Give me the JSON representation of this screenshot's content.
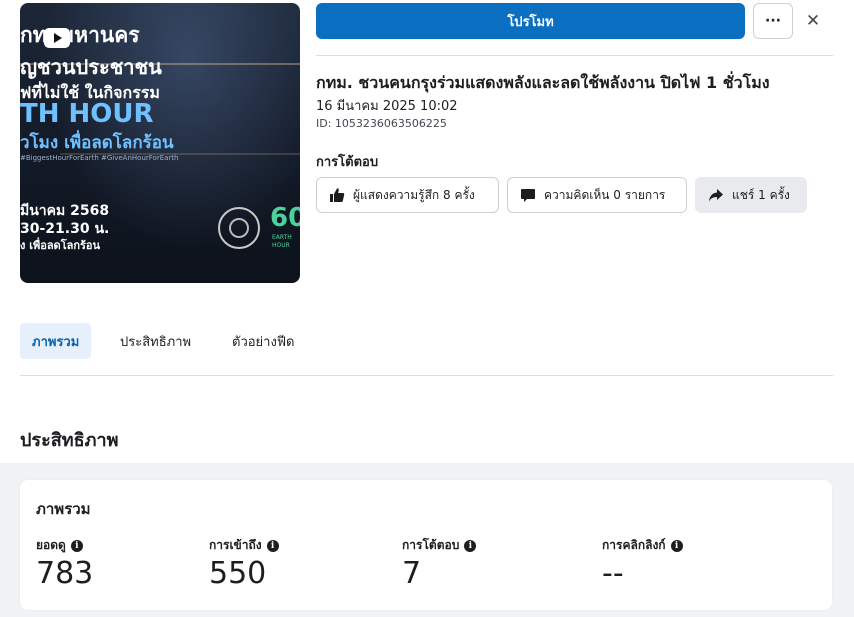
{
  "thumbnail": {
    "lines": [
      "กทมมหานคร",
      "ญชวนประชาชน",
      "ฟที่ไม่ใช้ ในกิจกรรม",
      "TH HOUR",
      "ัวโมง เพื่อลดโลกร้อน",
      "#BiggestHourForEarth #GiveAnHourForEarth",
      "มีนาคม 2568",
      "30-21.30 น.",
      "ง เพื่อลดโลกร้อน"
    ],
    "badge_number": "60",
    "badge_text": "EARTH HOUR"
  },
  "header": {
    "promote_label": "โปรโมท",
    "more_label": "···",
    "close_label": "✕"
  },
  "post": {
    "title": "กทม. ชวนคนกรุงร่วมแสดงพลังและลดใช้พลังงาน ปิดไฟ 1 ชั่วโมง",
    "date": "16 มีนาคม 2025 10:02",
    "id": "ID: 1053236063506225"
  },
  "interactions": {
    "title": "การโต้ตอบ",
    "reactions_label": "ผู้แสดงความรู้สึก 8 ครั้ง",
    "comments_label": "ความคิดเห็น 0 รายการ",
    "shares_label": "แชร์ 1 ครั้ง"
  },
  "tabs": [
    {
      "label": "ภาพรวม",
      "active": true
    },
    {
      "label": "ประสิทธิภาพ",
      "active": false
    },
    {
      "label": "ตัวอย่างฟีด",
      "active": false
    }
  ],
  "performance": {
    "section_title": "ประสิทธิภาพ",
    "card_title": "ภาพรวม",
    "info_icon": "i",
    "metrics": [
      {
        "label": "ยอดดู",
        "value": "783"
      },
      {
        "label": "การเข้าถึง",
        "value": "550"
      },
      {
        "label": "การโต้ตอบ",
        "value": "7"
      },
      {
        "label": "การคลิกลิงก์",
        "value": "--"
      }
    ]
  },
  "colors": {
    "primary": "#0a6ec1",
    "active_tab_bg": "#e7f0fa",
    "active_tab_text": "#0a63b0"
  },
  "icons": [
    "play-icon",
    "more-icon",
    "close-icon",
    "thumbs-up-icon",
    "comment-icon",
    "share-icon",
    "info-icon"
  ]
}
